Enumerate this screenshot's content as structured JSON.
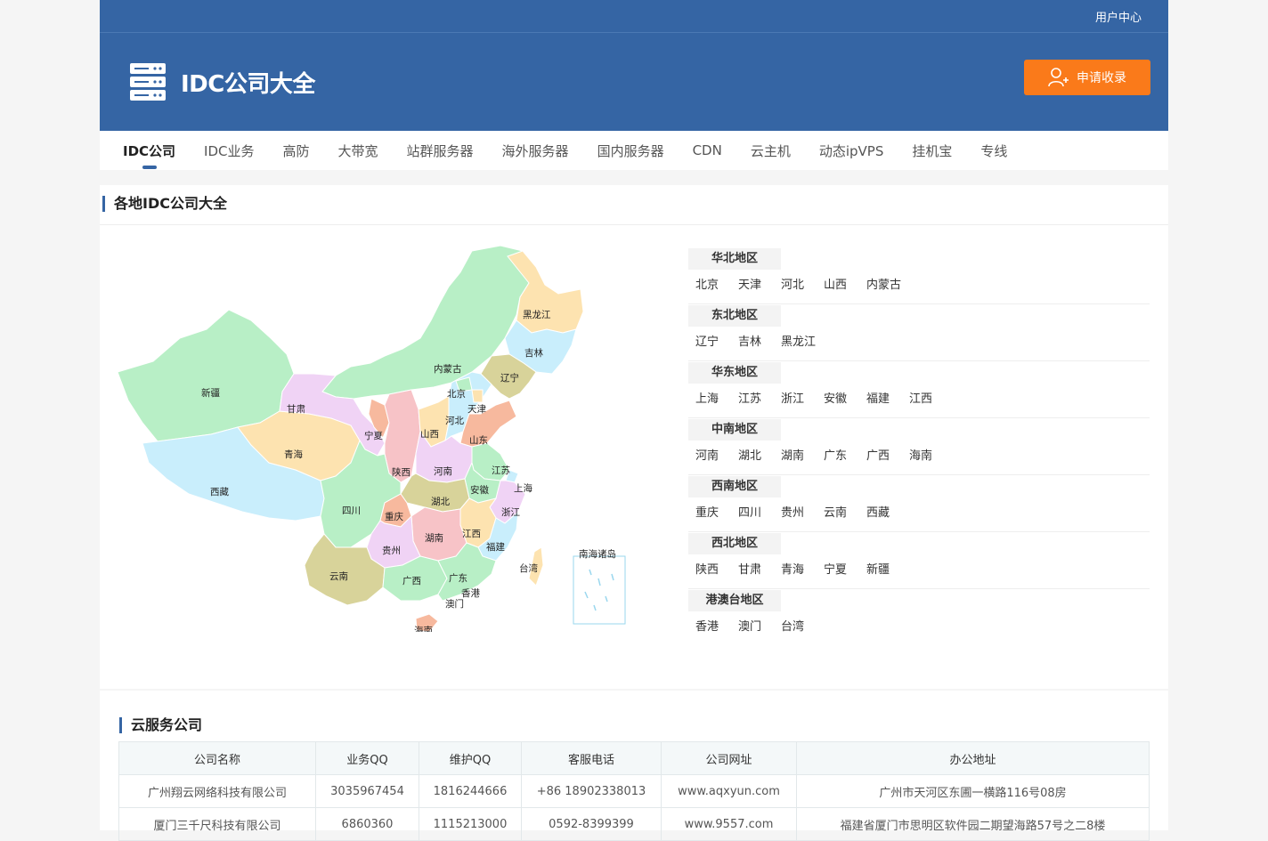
{
  "topbar": {
    "user_center": "用户中心"
  },
  "header": {
    "logo_text": "IDC公司大全",
    "apply_button": "申请收录"
  },
  "nav": [
    "IDC公司",
    "IDC业务",
    "高防",
    "大带宽",
    "站群服务器",
    "海外服务器",
    "国内服务器",
    "CDN",
    "云主机",
    "动态ipVPS",
    "挂机宝",
    "专线"
  ],
  "map_section": {
    "title": "各地IDC公司大全",
    "map_labels": {
      "heilongjiang": "黑龙江",
      "jilin": "吉林",
      "liaoning": "辽宁",
      "neimenggu": "内蒙古",
      "beijing": "北京",
      "tianjin": "天津",
      "hebei": "河北",
      "shanxi": "山西",
      "shandong": "山东",
      "xinjiang": "新疆",
      "gansu": "甘肃",
      "ningxia": "宁夏",
      "qinghai": "青海",
      "shaanxi": "陕西",
      "henan": "河南",
      "jiangsu": "江苏",
      "anhui": "安徽",
      "shanghai": "上海",
      "xizang": "西藏",
      "sichuan": "四川",
      "hubei": "湖北",
      "chongqing": "重庆",
      "zhejiang": "浙江",
      "jiangxi": "江西",
      "hunan": "湖南",
      "guizhou": "贵州",
      "fujian": "福建",
      "yunnan": "云南",
      "guangxi": "广西",
      "guangdong": "广东",
      "xianggang": "香港",
      "aomen": "澳门",
      "taiwan": "台湾",
      "hainan": "海南",
      "nanhai": "南海诸岛"
    },
    "regions": [
      {
        "name": "华北地区",
        "cities": [
          "北京",
          "天津",
          "河北",
          "山西",
          "内蒙古"
        ]
      },
      {
        "name": "东北地区",
        "cities": [
          "辽宁",
          "吉林",
          "黑龙江"
        ]
      },
      {
        "name": "华东地区",
        "cities": [
          "上海",
          "江苏",
          "浙江",
          "安徽",
          "福建",
          "江西"
        ]
      },
      {
        "name": "中南地区",
        "cities": [
          "河南",
          "湖北",
          "湖南",
          "广东",
          "广西",
          "海南"
        ]
      },
      {
        "name": "西南地区",
        "cities": [
          "重庆",
          "四川",
          "贵州",
          "云南",
          "西藏"
        ]
      },
      {
        "name": "西北地区",
        "cities": [
          "陕西",
          "甘肃",
          "青海",
          "宁夏",
          "新疆"
        ]
      },
      {
        "name": "港澳台地区",
        "cities": [
          "香港",
          "澳门",
          "台湾"
        ]
      }
    ]
  },
  "cloud_section": {
    "title": "云服务公司",
    "columns": [
      "公司名称",
      "业务QQ",
      "维护QQ",
      "客服电话",
      "公司网址",
      "办公地址"
    ],
    "rows": [
      [
        "广州翔云网络科技有限公司",
        "3035967454",
        "1816244666",
        "+86 18902338013",
        "www.aqxyun.com",
        "广州市天河区东圃一横路116号08房"
      ],
      [
        "厦门三千尺科技有限公司",
        "6860360",
        "1115213000",
        "0592-8399399",
        "www.9557.com",
        "福建省厦门市思明区软件园二期望海路57号之二8楼"
      ]
    ]
  },
  "colors": {
    "brand_blue": "#3565a4",
    "orange": "#fa7a1a"
  }
}
